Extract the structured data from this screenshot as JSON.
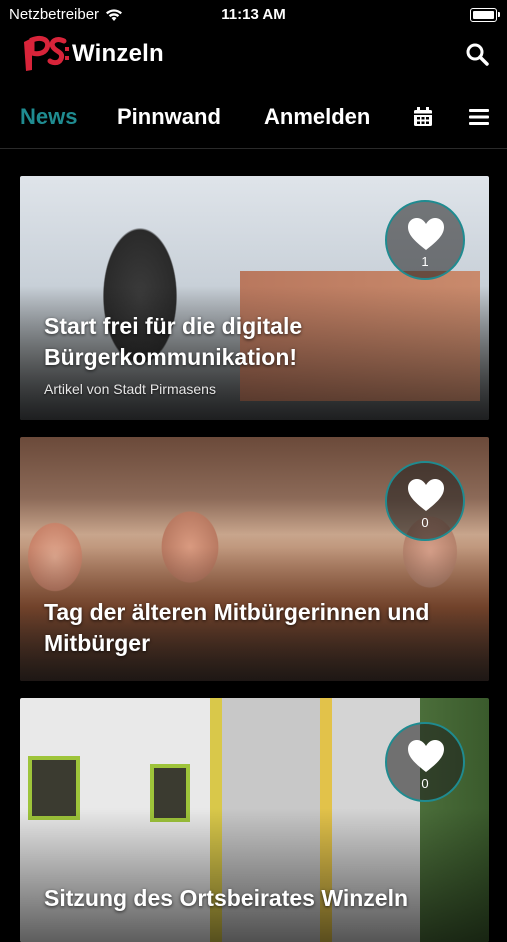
{
  "status": {
    "carrier": "Netzbetreiber",
    "time": "11:13 AM"
  },
  "header": {
    "logo_prefix": "ps:",
    "logo_text": "Winzeln"
  },
  "nav": {
    "tabs": [
      "News",
      "Pinnwand",
      "Anmelden"
    ],
    "active": "News"
  },
  "colors": {
    "accent": "#1f8b90",
    "logo_red": "#d8243a"
  },
  "articles": [
    {
      "title": "Start frei für die digitale Bürgerkommunikation!",
      "meta": "Artikel von Stadt Pirmasens",
      "likes": "1"
    },
    {
      "title": "Tag der älteren Mitbürgerinnen und Mitbürger",
      "likes": "0"
    },
    {
      "title": "Sitzung des Ortsbeirates Winzeln",
      "likes": "0"
    }
  ]
}
